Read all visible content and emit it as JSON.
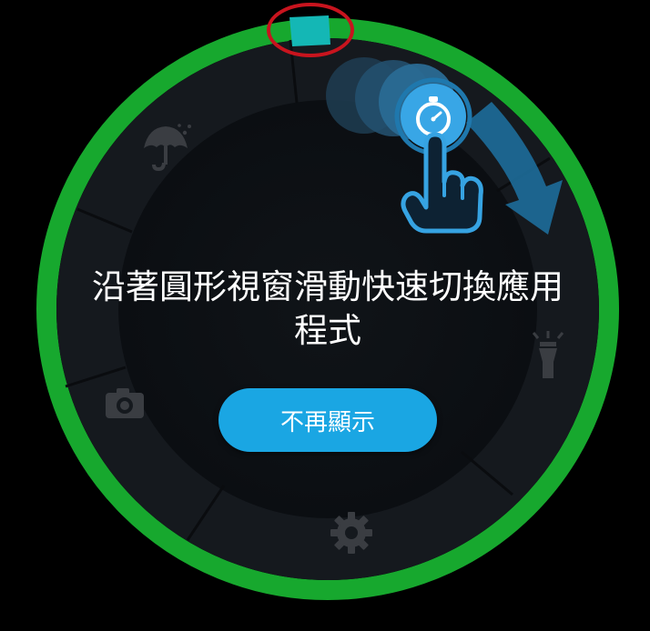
{
  "tutorial": {
    "message_line1": "沿著圓形視窗滑動快速切換應用",
    "message_line2": "程式",
    "dismiss_label": "不再顯示"
  },
  "ring": {
    "app_icons": [
      "umbrella-icon",
      "flashlight-icon",
      "gear-icon",
      "camera-icon",
      "stopwatch-icon"
    ]
  },
  "gesture": {
    "icons": [
      "pointing-hand-icon",
      "swipe-arrow-icon"
    ]
  },
  "colors": {
    "bezel_green": "#17a82e",
    "highlight_cyan": "#14b7b5",
    "indicator_red": "#c8141e",
    "button_blue": "#1aa6e3",
    "icon_gray": "#3a3d42",
    "gesture_blue": "#2a8fd0"
  }
}
